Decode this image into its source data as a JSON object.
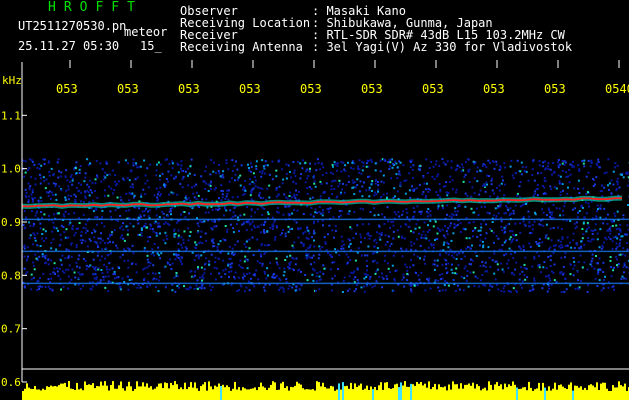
{
  "header": {
    "brand": "HROFFT",
    "file_name": "UT2511270530.pn",
    "mode": "meteor",
    "datetime": "25.11.27 05:30",
    "interval": "15_"
  },
  "info": {
    "labels": [
      "Observer",
      "Receiving Location",
      "Receiver",
      "Receiving Antenna"
    ],
    "values": [
      ": Masaki Kano",
      ": Shibukawa, Gunma, Japan",
      ": RTL-SDR SDR# 43dB L15 103.2MHz CW",
      ": 3el Yagi(V) Az 330 for Vladivostok"
    ]
  },
  "chart_data": {
    "type": "heatmap",
    "ylabel": "kHz",
    "ylim": [
      0.6,
      1.2
    ],
    "y_ticks": [
      "1.1",
      "1.0",
      "0.9",
      "0.8",
      "0.7",
      "0.6"
    ],
    "x_ticks": [
      "053",
      "053",
      "053",
      "053",
      "053",
      "053",
      "053",
      "053",
      "053",
      "0540"
    ],
    "carrier_khz": 0.935,
    "secondary_lines_khz": [
      0.905,
      0.845,
      0.785
    ],
    "noise_band_khz": [
      0.77,
      1.02
    ]
  },
  "colors": {
    "background": "#000000",
    "text_white": "#ffffff",
    "text_yellow": "#ffff00",
    "brand_green": "#00e000",
    "noise_blue": "#1020c0",
    "carrier_red": "#ff2020"
  }
}
